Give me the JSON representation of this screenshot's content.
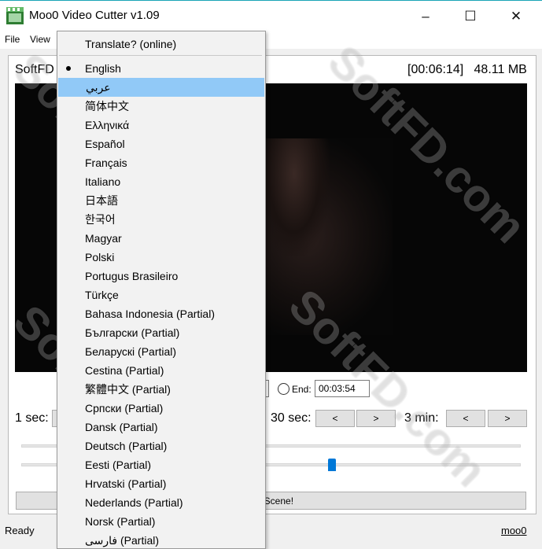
{
  "window": {
    "title": "Moo0 Video Cutter v1.09",
    "minimize": "–",
    "maximize": "☐",
    "close": "✕"
  },
  "menu": {
    "file": "File",
    "view": "View"
  },
  "header": {
    "label": "SoftFD",
    "duration": "[00:06:14]",
    "size": "48.11 MB"
  },
  "trim": {
    "end_label": "End:",
    "end_value": "00:03:54"
  },
  "seek": {
    "one_sec": "1 sec:",
    "thirty_sec": "30 sec:",
    "three_min": "3 min:",
    "back": "<",
    "forward": ">"
  },
  "action": {
    "partial_label": "his Scene!"
  },
  "status": {
    "left": "Ready",
    "right": "moo0"
  },
  "language_menu": {
    "translate": "Translate? (online)",
    "selected": "English",
    "highlighted": "عربي",
    "items": [
      "English",
      "عربي",
      "简体中文",
      "Ελληνικά",
      "Español",
      "Français",
      "Italiano",
      "日本語",
      "한국어",
      "Magyar",
      "Polski",
      "Portugus Brasileiro",
      "Türkçe",
      "Bahasa Indonesia (Partial)",
      "Български (Partial)",
      "Беларускі (Partial)",
      "Cestina (Partial)",
      "繁體中文 (Partial)",
      "Српски (Partial)",
      "Dansk (Partial)",
      "Deutsch (Partial)",
      "Eesti (Partial)",
      "Hrvatski (Partial)",
      "Nederlands (Partial)",
      "Norsk (Partial)",
      "فارسی (Partial)"
    ]
  },
  "watermark": "SoftFD.com",
  "colors": {
    "accent": "#0078d7",
    "highlight": "#91c9f7",
    "border_top": "#1aa5b6"
  }
}
